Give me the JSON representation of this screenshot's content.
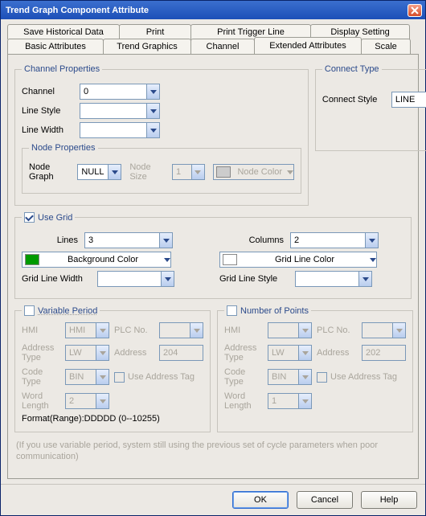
{
  "window": {
    "title": "Trend Graph Component Attribute"
  },
  "tabs_back": [
    {
      "label": "Save Historical Data"
    },
    {
      "label": "Print"
    },
    {
      "label": "Print Trigger Line"
    },
    {
      "label": "Display Setting"
    }
  ],
  "tabs_front": [
    {
      "label": "Basic Attributes"
    },
    {
      "label": "Trend Graphics"
    },
    {
      "label": "Channel"
    },
    {
      "label": "Extended Attributes"
    },
    {
      "label": "Scale"
    }
  ],
  "channel_props": {
    "legend": "Channel Properties",
    "channel_label": "Channel",
    "channel_value": "0",
    "line_style_label": "Line Style",
    "line_style_value": "",
    "line_width_label": "Line Width",
    "line_width_value": ""
  },
  "connect": {
    "legend": "Connect Type",
    "style_label": "Connect Style",
    "style_value": "LINE"
  },
  "node_props": {
    "legend": "Node Properties",
    "graph_label": "Node Graph",
    "graph_value": "NULL",
    "size_label": "Node Size",
    "size_value": "1",
    "color_label": "Node Color"
  },
  "grid": {
    "use_label": "Use Grid",
    "lines_label": "Lines",
    "lines_value": "3",
    "cols_label": "Columns",
    "cols_value": "2",
    "bg_label": "Background Color",
    "bg_color": "#009a00",
    "line_color_label": "Grid Line Color",
    "line_color": "#ffffff",
    "line_width_label": "Grid Line Width",
    "line_width_value": "",
    "line_style_label": "Grid Line Style",
    "line_style_value": ""
  },
  "var_period": {
    "legend": "Variable Period",
    "hmi_label": "HMI",
    "hmi_value": "HMI",
    "plcno_label": "PLC No.",
    "plcno_value": "",
    "addrtype_label": "Address Type",
    "addrtype_value": "LW",
    "address_label": "Address",
    "address_value": "204",
    "codetype_label": "Code Type",
    "codetype_value": "BIN",
    "use_addr_tag": "Use Address Tag",
    "wordlen_label": "Word Length",
    "wordlen_value": "2",
    "format": "Format(Range):DDDDD (0--10255)"
  },
  "num_points": {
    "legend": "Number of Points",
    "hmi_label": "HMI",
    "hmi_value": "",
    "plcno_label": "PLC No.",
    "plcno_value": "",
    "addrtype_label": "Address Type",
    "addrtype_value": "LW",
    "address_label": "Address",
    "address_value": "202",
    "codetype_label": "Code Type",
    "codetype_value": "BIN",
    "use_addr_tag": "Use Address Tag",
    "wordlen_label": "Word Length",
    "wordlen_value": "1"
  },
  "info": "(If you use variable period, system still using the previous set of cycle parameters when poor communication)",
  "buttons": {
    "ok": "OK",
    "cancel": "Cancel",
    "help": "Help"
  }
}
